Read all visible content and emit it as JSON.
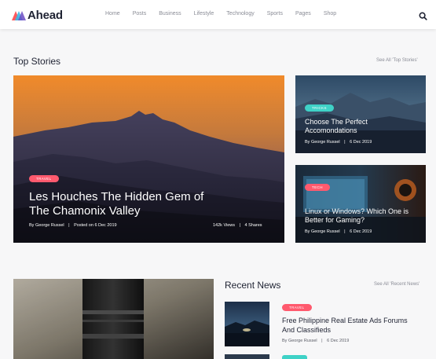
{
  "header": {
    "logo_text": "Ahead",
    "nav": [
      "Home",
      "Posts",
      "Business",
      "Lifestyle",
      "Technology",
      "Sports",
      "Pages",
      "Shop"
    ]
  },
  "top_stories": {
    "title": "Top Stories",
    "see_all": "See All 'Top Stories'",
    "featured": {
      "badge": "TRAVEL",
      "title_line1": "Les Houches The Hidden Gem of",
      "title_line2": "The Chamonix Valley",
      "by": "By George Russel",
      "posted": "Posted on 6 Dec 2019",
      "views": "142k Views",
      "shares": "4 Shares"
    },
    "side1": {
      "badge": "TRICKS",
      "title_line1": "Choose The Perfect",
      "title_line2": "Accomondations",
      "meta_by": "By George Russel",
      "meta_date": "6 Dec 2019"
    },
    "side2": {
      "badge": "TECH",
      "title_line1": "Linux or Windows? Which One is",
      "title_line2": "Better for Gaming?",
      "meta_by": "By George Russel",
      "meta_date": "6 Dec 2019"
    }
  },
  "recent_news": {
    "title": "Recent News",
    "see_all": "See All 'Recent News'",
    "items": [
      {
        "badge": "TRAVEL",
        "title_line1": "Free Philippine Real Estate Ads Forums",
        "title_line2": "And Classifieds",
        "meta_by": "By George Russel",
        "meta_date": "6 Dec 2019"
      }
    ]
  },
  "colors": {
    "accent_red": "#ff5a6e",
    "accent_teal": "#3fd2c7",
    "text_dark": "#1f2333"
  },
  "icons": {
    "search": "search-icon",
    "logo": "ahead-logo-icon",
    "separator": "|"
  }
}
